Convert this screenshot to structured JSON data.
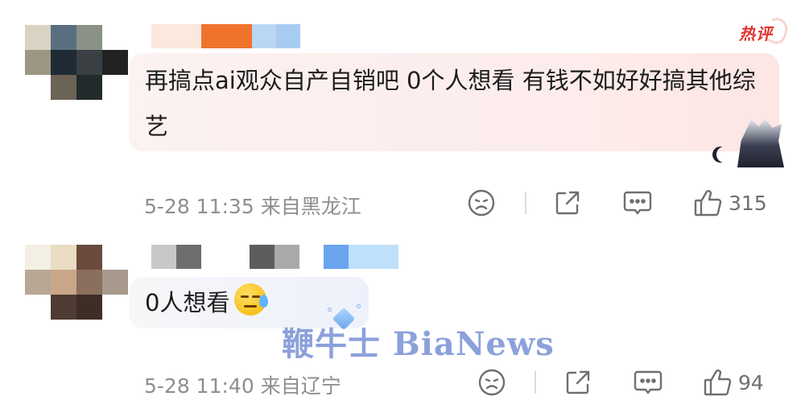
{
  "hot_badge": "热评",
  "comments": [
    {
      "text": "再搞点ai观众自产自销吧 0个人想看 有钱不如好好搞其他综艺",
      "time": "5-28 11:35",
      "location": "来自黑龙江",
      "likes": "315",
      "avatar_pixels": [
        "#d8d3c2",
        "#5a6e82",
        "#8a9186",
        "#ffffff",
        "#9b9783",
        "#1f2a34",
        "#3b4045",
        "#222",
        "#ffffff",
        "#6b6355",
        "#222a2b",
        "#ffffff"
      ],
      "name_pixels": [
        "#fbe8de",
        "#f0732c",
        "#b9d7f3",
        "#a8ccf0"
      ]
    },
    {
      "text": "0人想看",
      "emoji": "sweat-face-emoji",
      "time": "5-28 11:40",
      "location": "来自辽宁",
      "likes": "94",
      "avatar_pixels": [
        "#f3efe4",
        "#e9dcc2",
        "#6b4a3e",
        "#ffffff",
        "#b8a794",
        "#c9a789",
        "#8a6f5e",
        "#a79a8c",
        "#ffffff",
        "#4e3b33",
        "#3e2d27",
        "#ffffff"
      ],
      "name_pixels": [
        "#c8c8c8",
        "#6e6e6e",
        "#ffffff",
        "#5d5d5d",
        "#a9a9a9",
        "#ffffff",
        "#6aa3ee",
        "#bfe0fb"
      ]
    }
  ],
  "watermark": "鞭牛士 BiaNews",
  "colors": {
    "hot": "#e3332f",
    "meta": "#8e8e8e",
    "icon": "#6f6f6f"
  }
}
